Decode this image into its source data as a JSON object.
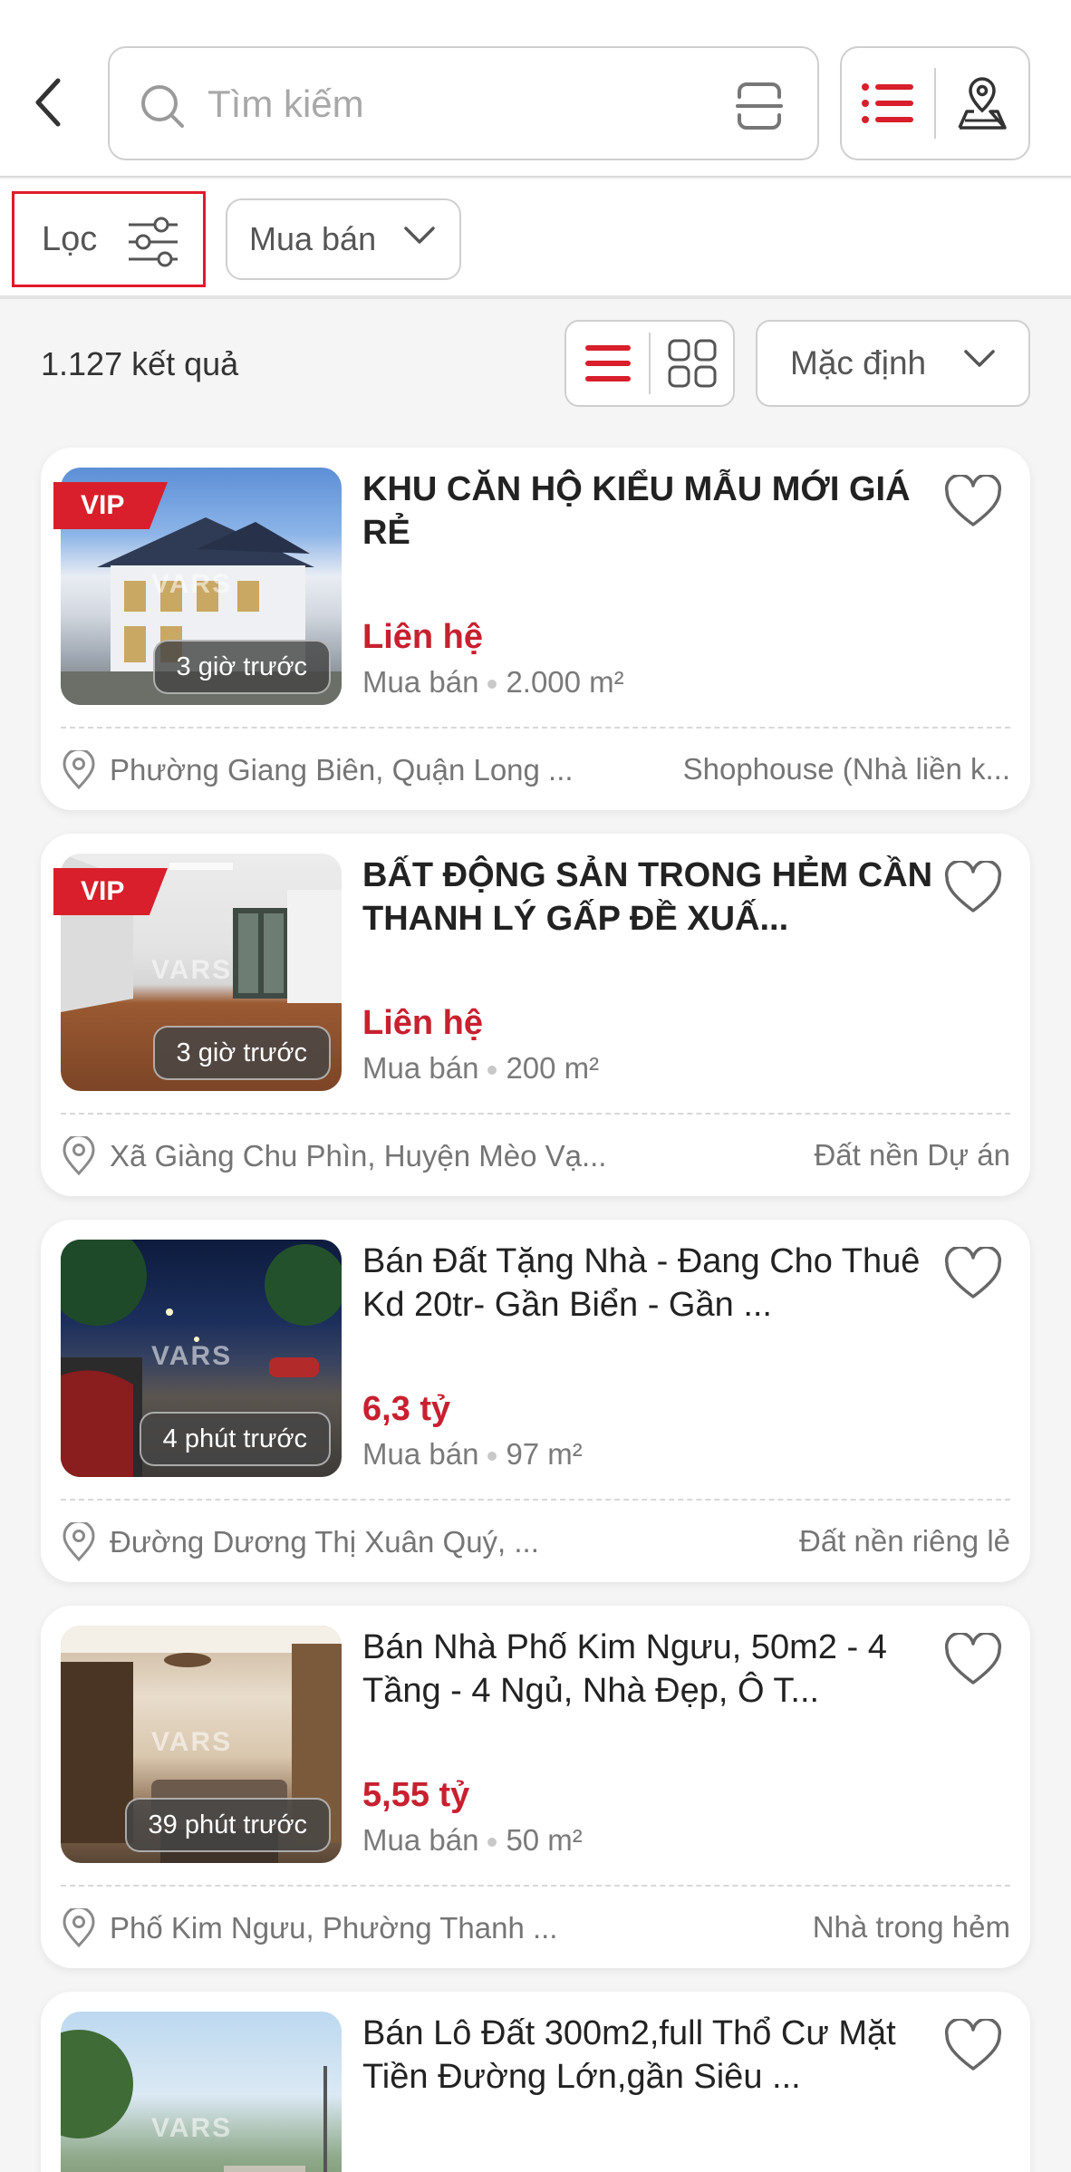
{
  "search": {
    "placeholder": "Tìm kiếm"
  },
  "filter": {
    "label": "Lọc"
  },
  "type_dropdown": {
    "selected": "Mua bán"
  },
  "results": {
    "count_text": "1.127 kết quả"
  },
  "sort_dropdown": {
    "selected": "Mặc định"
  },
  "colors": {
    "accent": "#d81f2b",
    "price": "#c8202f",
    "border": "#cfcfcf"
  },
  "listings": [
    {
      "title": "KHU CĂN HỘ KIỂU MẪU MỚI GIÁ RẺ",
      "vip": "VIP",
      "time": "3 giờ trước",
      "price": "Liên hệ",
      "deal_type": "Mua bán",
      "area": "2.000 m²",
      "location": "Phường Giang Biên, Quận Long ...",
      "category": "Shophouse (Nhà liền k...",
      "watermark": "VARS"
    },
    {
      "title": "BẤT ĐỘNG SẢN TRONG HẺM CẦN THANH LÝ GẤP ĐỀ XUẤ...",
      "vip": "VIP",
      "time": "3 giờ trước",
      "price": "Liên hệ",
      "deal_type": "Mua bán",
      "area": "200 m²",
      "location": "Xã Giàng Chu Phìn, Huyện Mèo Vạ...",
      "category": "Đất nền Dự án",
      "watermark": "VARS"
    },
    {
      "title": "Bán Đất Tặng Nhà - Đang Cho Thuê Kd 20tr- Gần Biển - Gần ...",
      "time": "4 phút trước",
      "price": "6,3 tỷ",
      "deal_type": "Mua bán",
      "area": "97 m²",
      "location": "Đường Dương Thị Xuân Quý, ...",
      "category": "Đất nền riêng lẻ",
      "watermark": "VARS"
    },
    {
      "title": "Bán Nhà Phố Kim Ngưu, 50m2 - 4 Tầng - 4 Ngủ, Nhà Đẹp, Ô T...",
      "time": "39 phút trước",
      "price": "5,55 tỷ",
      "deal_type": "Mua bán",
      "area": "50 m²",
      "location": "Phố Kim Ngưu, Phường Thanh ...",
      "category": "Nhà trong hẻm",
      "watermark": "VARS"
    },
    {
      "title": "Bán Lô Đất 300m2,full Thổ Cư Mặt Tiền Đường Lớn,gần Siêu ...",
      "watermark": "VARS"
    }
  ]
}
